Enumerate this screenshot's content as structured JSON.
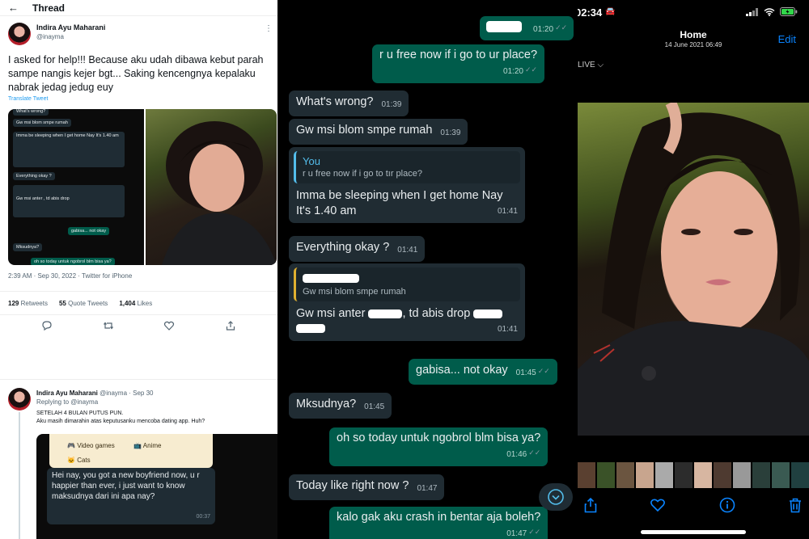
{
  "twitter": {
    "header_title": "Thread",
    "author_name": "Indira Ayu Maharani",
    "author_handle": "@inayma",
    "tweet_text": "I asked for help!!! Because aku udah dibawa kebut parah sampe nangis kejer bgt... Saking kencengnya kepalaku nabrak jedag jedug euy",
    "translate_label": "Translate Tweet",
    "meta": "2:39 AM · Sep 30, 2022 · Twitter for iPhone",
    "stats": {
      "retweets_count": "129",
      "retweets_label": "Retweets",
      "quotes_count": "55",
      "quotes_label": "Quote Tweets",
      "likes_count": "1,404",
      "likes_label": "Likes"
    },
    "mini_chat": [
      {
        "text": "What's wrong?",
        "dir": "in"
      },
      {
        "text": "Gw msi blom smpe rumah",
        "dir": "in"
      },
      {
        "text": "Imma be sleeping when I get home Nay It's 1.40 am",
        "dir": "in"
      },
      {
        "text": "Everything okay ?",
        "dir": "in"
      },
      {
        "text": "Gw msi blom smpe rumah",
        "dir": "in"
      },
      {
        "text": "Gw msi anter , td abis drop",
        "dir": "in"
      },
      {
        "text": "gabisa... not okay",
        "dir": "out"
      },
      {
        "text": "Mksudnya?",
        "dir": "in"
      },
      {
        "text": "oh so today untuk ngobrol blm bisa ya?",
        "dir": "out"
      }
    ],
    "reply": {
      "author_name": "Indira Ayu Maharani",
      "meta": "@inayma · Sep 30",
      "replying_to": "Replying to @inayma",
      "text_line1": "SETELAH 4 BULAN PUTUS PUN.",
      "text_line2": "Aku masih dimarahin atas keputusanku mencoba dating app. Huh?",
      "chip_video": "Video games",
      "chip_anime": "Anime",
      "chip_cats": "Cats",
      "bubble_text": "Hei nay, you got a new boyfriend now, u r happier than ever, i just want to know maksudnya dari ini apa nay?",
      "bubble_time": "00:37"
    }
  },
  "whatsapp": {
    "messages": {
      "m1_time": "01:20",
      "m2_text": "r u free now if i go to ur place?",
      "m2_time": "01:20",
      "m3_text": "What's wrong?",
      "m3_time": "01:39",
      "m4_text": "Gw msi blom smpe rumah",
      "m4_time": "01:39",
      "m5_quote_name": "You",
      "m5_quote_text": "r u free now if i go to tır place?",
      "m5_line1": "Imma be sleeping when I get home Nay",
      "m5_line2": "It's 1.40 am",
      "m5_time": "01:41",
      "m6_text": "Everything okay ?",
      "m6_time": "01:41",
      "m7_quote_text": "Gw msi blom smpe rumah",
      "m7_text_a": "Gw msi anter",
      "m7_text_b": ", td abis drop",
      "m7_time": "01:41",
      "m8_text": "gabisa... not okay",
      "m8_time": "01:45",
      "m9_text": "Mksudnya?",
      "m9_time": "01:45",
      "m10_text": "oh so today untuk ngobrol blm bisa ya?",
      "m10_time": "01:46",
      "m11_text": "Today like right now ?",
      "m11_time": "01:47",
      "m12_text": "kalo gak aku crash in bentar aja boleh?",
      "m12_time": "01:47"
    }
  },
  "photos": {
    "clock": "02:34",
    "title": "Home",
    "date": "14 June 2021 06:49",
    "edit_label": "Edit",
    "live_label": "LIVE"
  },
  "colors": {
    "whatsapp_out": "#005c4b",
    "whatsapp_in": "#202c33",
    "ios_blue": "#0a84ff",
    "twitter_blue": "#1d9bf0"
  }
}
